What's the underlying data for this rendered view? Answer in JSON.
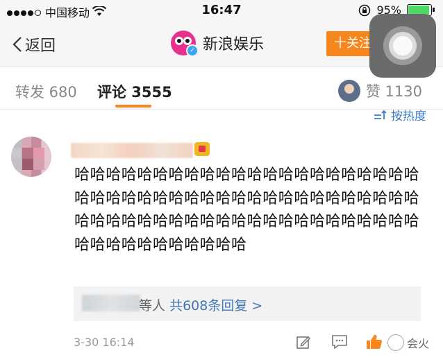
{
  "status_bar": {
    "carrier": "中国移动",
    "time": "16:47",
    "battery": "95%",
    "battery_level": 0.95
  },
  "nav": {
    "back_label": "返回",
    "title": "新浪娱乐",
    "follow_label": "十关注"
  },
  "tabs": {
    "repost": "转发 680",
    "comment": "评论 3555",
    "like": "赞 1130"
  },
  "sort_label": "按热度",
  "comment": {
    "text": "哈哈哈哈哈哈哈哈哈哈哈哈哈哈哈哈哈哈哈哈哈哈哈哈哈哈哈哈哈哈哈哈哈哈哈哈哈哈哈哈哈哈哈哈哈哈哈哈哈哈哈哈哈哈哈哈哈哈哈哈哈哈哈哈哈哈哈哈哈哈哈哈哈哈哈哈哈",
    "reply_suffix": "等人",
    "reply_link": "共608条回复 >",
    "timestamp": "3-30 16:14"
  },
  "watermark": "会火",
  "icons": {
    "back": "chevron-left-icon",
    "wifi": "wifi-icon",
    "lock": "rotation-lock-icon",
    "edit": "edit-icon",
    "reply": "comment-icon",
    "like": "thumbs-up-icon"
  },
  "colors": {
    "accent": "#f7861c",
    "link": "#4377b5",
    "like": "#f7861c"
  }
}
